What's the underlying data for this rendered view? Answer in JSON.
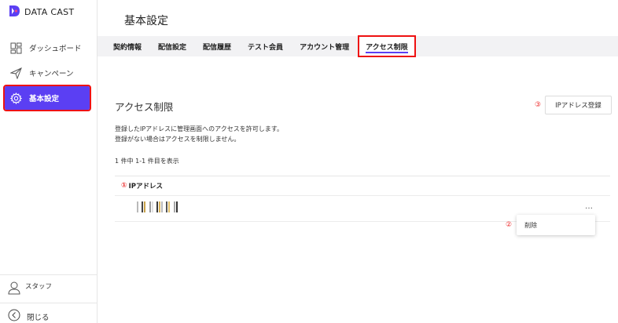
{
  "brand": {
    "name": "DATA CAST",
    "accent": "#5b3ff3"
  },
  "sidebar": {
    "items": [
      {
        "label": "ダッシュボード",
        "icon": "dashboard-icon"
      },
      {
        "label": "キャンペーン",
        "icon": "send-icon"
      },
      {
        "label": "基本設定",
        "icon": "gear-icon",
        "active": true
      }
    ],
    "staff_label": "スタッフ",
    "close_label": "閉じる"
  },
  "header": {
    "title": "基本設定"
  },
  "tabs": [
    {
      "label": "契約情報"
    },
    {
      "label": "配信設定"
    },
    {
      "label": "配信履歴"
    },
    {
      "label": "テスト会員"
    },
    {
      "label": "アカウント管理"
    },
    {
      "label": "アクセス制限",
      "active": true
    }
  ],
  "main": {
    "section_title": "アクセス制限",
    "register_marker": "③",
    "register_label": "IPアドレス登録",
    "description_line1": "登録したIPアドレスに管理画面へのアクセスを許可します。",
    "description_line2": "登録がない場合はアクセスを制限しません。",
    "count_text": "1 件中 1-1 件目を表示",
    "table": {
      "header_marker": "①",
      "header": "IPアドレス",
      "more_label": "…",
      "menu_marker": "②",
      "menu_item": "削除"
    }
  }
}
